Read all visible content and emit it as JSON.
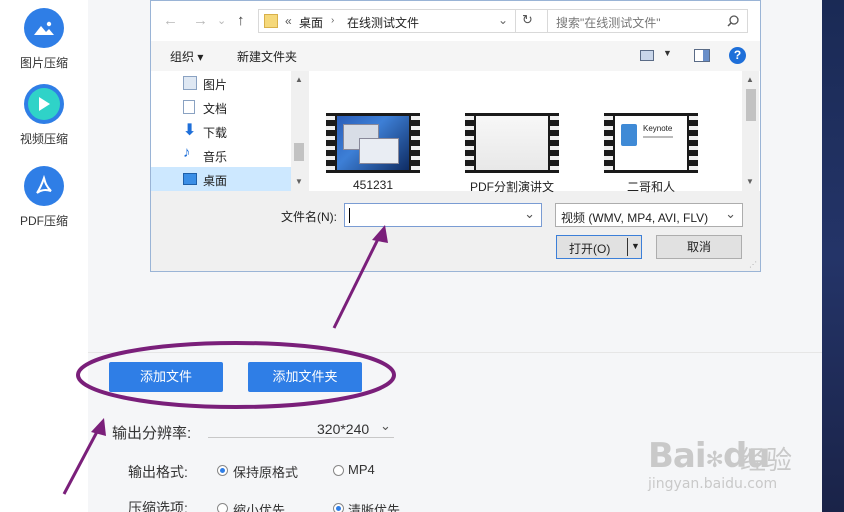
{
  "sidebar": {
    "items": [
      {
        "label": "图片压缩",
        "icon": "image-icon"
      },
      {
        "label": "视频压缩",
        "icon": "play-icon"
      },
      {
        "label": "PDF压缩",
        "icon": "pdf-icon"
      }
    ]
  },
  "dialog": {
    "breadcrumb_prefix": "«",
    "breadcrumb": [
      "桌面",
      "在线测试文件"
    ],
    "search_placeholder": "搜索\"在线测试文件\"",
    "toolbar": {
      "organize": "组织 ▾",
      "new_folder": "新建文件夹"
    },
    "nav_items": [
      {
        "label": "图片",
        "icon": "pictures-icon"
      },
      {
        "label": "文档",
        "icon": "documents-icon"
      },
      {
        "label": "下载",
        "icon": "download-icon"
      },
      {
        "label": "音乐",
        "icon": "music-icon"
      },
      {
        "label": "桌面",
        "icon": "desktop-icon",
        "selected": true
      }
    ],
    "files": [
      {
        "name": "451231"
      },
      {
        "name": "PDF分割演讲文"
      },
      {
        "name": "二哥和人",
        "thumb_text": "Keynote"
      }
    ],
    "filename_label": "文件名(N):",
    "filename_value": "",
    "filetype_value": "视频 (WMV, MP4, AVI, FLV)",
    "open_label": "打开(O)",
    "cancel_label": "取消"
  },
  "main": {
    "add_file": "添加文件",
    "add_folder": "添加文件夹",
    "resolution_label": "输出分辨率:",
    "resolution_value": "320*240",
    "format_label": "输出格式:",
    "format_options": [
      "保持原格式",
      "MP4"
    ],
    "compress_label": "压缩选项:",
    "compress_options": [
      "缩小优先",
      "清晰优先"
    ]
  },
  "watermark": {
    "brand": "Bai",
    "paw": "du",
    "cn": "经验",
    "url": "jingyan.baidu.com"
  },
  "colors": {
    "accent": "#2f7ee6",
    "annotation": "#7a1f7a"
  }
}
